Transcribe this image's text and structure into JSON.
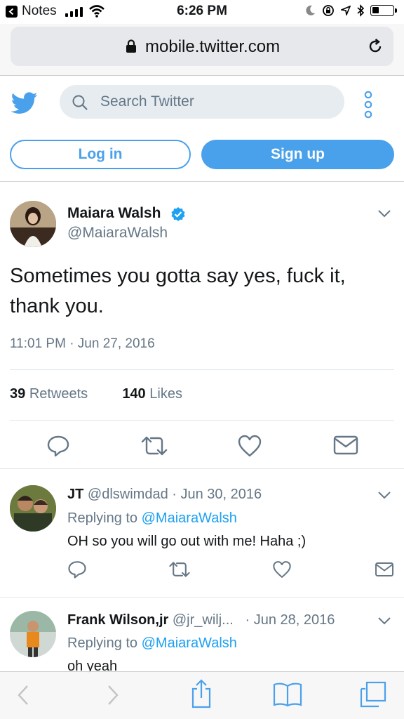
{
  "status_bar": {
    "app_back_label": "Notes",
    "time": "6:26 PM",
    "battery_level": 0.35
  },
  "browser": {
    "domain": "mobile.twitter.com"
  },
  "header": {
    "search_placeholder": "Search Twitter",
    "login_label": "Log in",
    "signup_label": "Sign up"
  },
  "tweet": {
    "author_name": "Maiara Walsh",
    "author_handle": "@MaiaraWalsh",
    "text": "Sometimes you gotta say yes, fuck it, thank you.",
    "timestamp": "11:01 PM · Jun 27, 2016",
    "retweets_count": "39",
    "retweets_label": "Retweets",
    "likes_count": "140",
    "likes_label": "Likes"
  },
  "replies": [
    {
      "name": "JT",
      "handle": "@dlswimdad",
      "date": "· Jun 30, 2016",
      "replying_prefix": "Replying to",
      "replying_to": "@MaiaraWalsh",
      "text": "OH so you will go out with me!  Haha ;)"
    },
    {
      "name": "Frank Wilson,jr",
      "handle": "@jr_wilj...",
      "date": "· Jun 28, 2016",
      "replying_prefix": "Replying to",
      "replying_to": "@MaiaraWalsh",
      "text": "oh yeah"
    }
  ],
  "icons": {
    "back": "chevron-left-icon",
    "share": "share-icon",
    "bookmarks": "book-icon",
    "tabs": "tabs-icon",
    "reply": "reply-icon",
    "retweet": "retweet-icon",
    "like": "heart-icon",
    "dm": "envelope-icon"
  },
  "colors": {
    "twitter_blue": "#4aa1eb",
    "link_blue": "#1da1f2",
    "gray_text": "#657786"
  }
}
